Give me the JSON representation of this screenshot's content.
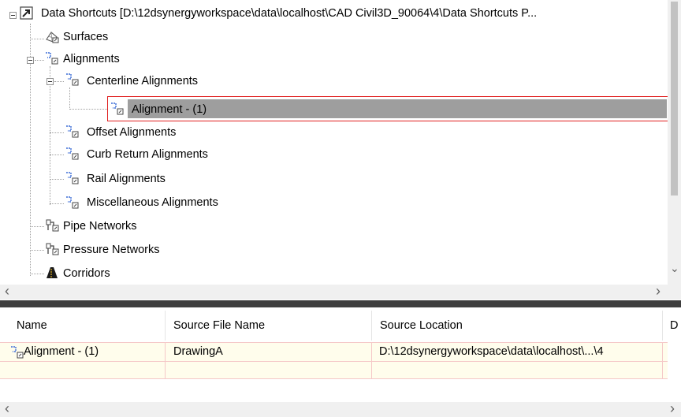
{
  "tree": {
    "root_label": "Data Shortcuts [D:\\12dsynergyworkspace\\data\\localhost\\CAD Civil3D_90064\\4\\Data Shortcuts P...",
    "surfaces": "Surfaces",
    "alignments": "Alignments",
    "centerline_alignments": "Centerline Alignments",
    "alignment_item": "Alignment - (1)",
    "offset_alignments": "Offset Alignments",
    "curb_return_alignments": "Curb Return Alignments",
    "rail_alignments": "Rail Alignments",
    "misc_alignments": "Miscellaneous Alignments",
    "pipe_networks": "Pipe Networks",
    "pressure_networks": "Pressure Networks",
    "corridors": "Corridors"
  },
  "list": {
    "columns": [
      "Name",
      "Source File Name",
      "Source Location",
      "D"
    ],
    "rows": [
      {
        "name": "Alignment - (1)",
        "source_file": "DrawingA",
        "source_location": "D:\\12dsynergyworkspace\\data\\localhost\\...\\4"
      }
    ]
  },
  "scroll": {
    "left_arrow": "‹",
    "right_arrow": "›",
    "down_arrow": "⌄"
  },
  "colors": {
    "selection_border": "#e02020",
    "selection_fill": "#9e9e9e",
    "row_fill": "#fffdec",
    "splitter": "#3e3e3e"
  }
}
